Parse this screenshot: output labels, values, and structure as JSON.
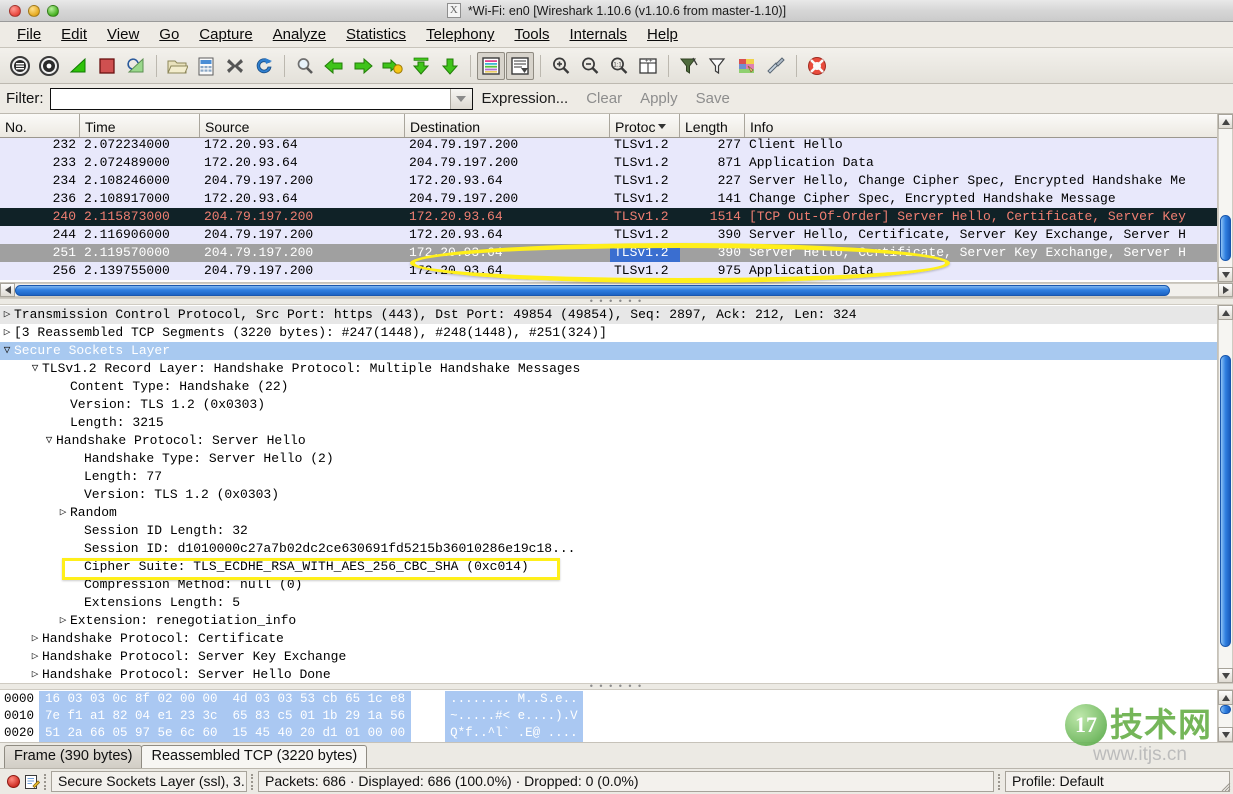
{
  "window": {
    "title": "*Wi-Fi: en0   [Wireshark 1.10.6  (v1.10.6 from master-1.10)]",
    "app_icon": "X"
  },
  "menu": {
    "items": [
      {
        "label": "File"
      },
      {
        "label": "Edit"
      },
      {
        "label": "View"
      },
      {
        "label": "Go"
      },
      {
        "label": "Capture"
      },
      {
        "label": "Analyze"
      },
      {
        "label": "Statistics"
      },
      {
        "label": "Telephony"
      },
      {
        "label": "Tools"
      },
      {
        "label": "Internals"
      },
      {
        "label": "Help"
      }
    ]
  },
  "toolbar": {
    "buttons": [
      {
        "name": "interfaces-icon"
      },
      {
        "name": "capture-options-icon"
      },
      {
        "name": "start-capture-icon"
      },
      {
        "name": "stop-capture-icon"
      },
      {
        "name": "restart-capture-icon"
      },
      {
        "name": "open-file-icon"
      },
      {
        "name": "save-file-icon"
      },
      {
        "name": "close-file-icon"
      },
      {
        "name": "reload-file-icon"
      },
      {
        "name": "find-packet-icon"
      },
      {
        "name": "go-back-icon"
      },
      {
        "name": "go-forward-icon"
      },
      {
        "name": "go-to-packet-icon"
      },
      {
        "name": "go-first-packet-icon"
      },
      {
        "name": "go-last-packet-icon"
      },
      {
        "name": "colorize-icon"
      },
      {
        "name": "auto-scroll-icon"
      },
      {
        "name": "zoom-in-icon"
      },
      {
        "name": "zoom-out-icon"
      },
      {
        "name": "zoom-normal-icon"
      },
      {
        "name": "resize-columns-icon"
      },
      {
        "name": "capture-filters-icon"
      },
      {
        "name": "display-filters-icon"
      },
      {
        "name": "coloring-rules-icon"
      },
      {
        "name": "preferences-icon"
      },
      {
        "name": "help-icon"
      }
    ]
  },
  "filter": {
    "label": "Filter:",
    "value": "",
    "placeholder": "",
    "expression_label": "Expression...",
    "clear_label": "Clear",
    "apply_label": "Apply",
    "save_label": "Save"
  },
  "packet_list": {
    "columns": [
      {
        "label": "No.",
        "sorted": false
      },
      {
        "label": "Time",
        "sorted": false
      },
      {
        "label": "Source",
        "sorted": false
      },
      {
        "label": "Destination",
        "sorted": false
      },
      {
        "label": "Protoc",
        "sorted": true
      },
      {
        "label": "Length",
        "sorted": false
      },
      {
        "label": "Info",
        "sorted": false
      }
    ],
    "rows": [
      {
        "no": "232",
        "time": "2.072234000",
        "src": "172.20.93.64",
        "dst": "204.79.197.200",
        "proto": "TLSv1.2",
        "len": "277",
        "info": "Client Hello",
        "style": "odd"
      },
      {
        "no": "233",
        "time": "2.072489000",
        "src": "172.20.93.64",
        "dst": "204.79.197.200",
        "proto": "TLSv1.2",
        "len": "871",
        "info": "Application Data",
        "style": "odd"
      },
      {
        "no": "234",
        "time": "2.108246000",
        "src": "204.79.197.200",
        "dst": "172.20.93.64",
        "proto": "TLSv1.2",
        "len": "227",
        "info": "Server Hello, Change Cipher Spec, Encrypted Handshake Me",
        "style": "odd"
      },
      {
        "no": "236",
        "time": "2.108917000",
        "src": "172.20.93.64",
        "dst": "204.79.197.200",
        "proto": "TLSv1.2",
        "len": "141",
        "info": "Change Cipher Spec, Encrypted Handshake Message",
        "style": "odd"
      },
      {
        "no": "240",
        "time": "2.115873000",
        "src": "204.79.197.200",
        "dst": "172.20.93.64",
        "proto": "TLSv1.2",
        "len": "1514",
        "info": "[TCP Out-Of-Order] Server Hello, Certificate, Server Key",
        "style": "bad"
      },
      {
        "no": "244",
        "time": "2.116906000",
        "src": "204.79.197.200",
        "dst": "172.20.93.64",
        "proto": "TLSv1.2",
        "len": "390",
        "info": "Server Hello, Certificate, Server Key Exchange, Server H",
        "style": "odd"
      },
      {
        "no": "251",
        "time": "2.119570000",
        "src": "204.79.197.200",
        "dst": "172.20.93.64",
        "proto": "TLSv1.2",
        "len": "390",
        "info": "Server Hello, Certificate, Server Key Exchange, Server H",
        "style": "sel"
      },
      {
        "no": "256",
        "time": "2.139755000",
        "src": "204.79.197.200",
        "dst": "172.20.93.64",
        "proto": "TLSv1.2",
        "len": "975",
        "info": "Application Data",
        "style": "odd"
      }
    ]
  },
  "detail_tree": {
    "rows": [
      {
        "indent": 0,
        "twisty": "collapsed",
        "text": "Transmission Control Protocol, Src Port: https (443), Dst Port: 49854 (49854), Seq: 2897, Ack: 212, Len: 324",
        "style": "shaded"
      },
      {
        "indent": 0,
        "twisty": "collapsed",
        "text": "[3 Reassembled TCP Segments (3220 bytes): #247(1448), #248(1448), #251(324)]",
        "style": "plain"
      },
      {
        "indent": 0,
        "twisty": "expanded",
        "text": "Secure Sockets Layer",
        "style": "ssl-sel"
      },
      {
        "indent": 1,
        "twisty": "expanded",
        "text": "TLSv1.2 Record Layer: Handshake Protocol: Multiple Handshake Messages",
        "style": "plain"
      },
      {
        "indent": 2,
        "twisty": "none",
        "text": "Content Type: Handshake (22)",
        "style": "plain"
      },
      {
        "indent": 2,
        "twisty": "none",
        "text": "Version: TLS 1.2 (0x0303)",
        "style": "plain"
      },
      {
        "indent": 2,
        "twisty": "none",
        "text": "Length: 3215",
        "style": "plain"
      },
      {
        "indent": 2,
        "twisty": "expanded",
        "text": "Handshake Protocol: Server Hello",
        "style": "plain"
      },
      {
        "indent": 3,
        "twisty": "none",
        "text": "Handshake Type: Server Hello (2)",
        "style": "plain"
      },
      {
        "indent": 3,
        "twisty": "none",
        "text": "Length: 77",
        "style": "plain"
      },
      {
        "indent": 3,
        "twisty": "none",
        "text": "Version: TLS 1.2 (0x0303)",
        "style": "plain"
      },
      {
        "indent": 3,
        "twisty": "collapsed",
        "text": "Random",
        "style": "plain"
      },
      {
        "indent": 3,
        "twisty": "none",
        "text": "Session ID Length: 32",
        "style": "plain"
      },
      {
        "indent": 3,
        "twisty": "none",
        "text": "Session ID: d1010000c27a7b02dc2ce630691fd5215b36010286e19c18...",
        "style": "plain"
      },
      {
        "indent": 3,
        "twisty": "none",
        "text": "Cipher Suite: TLS_ECDHE_RSA_WITH_AES_256_CBC_SHA (0xc014)",
        "style": "plain"
      },
      {
        "indent": 3,
        "twisty": "none",
        "text": "Compression Method: null (0)",
        "style": "plain"
      },
      {
        "indent": 3,
        "twisty": "none",
        "text": "Extensions Length: 5",
        "style": "plain"
      },
      {
        "indent": 3,
        "twisty": "collapsed",
        "text": "Extension: renegotiation_info",
        "style": "plain"
      },
      {
        "indent": 2,
        "twisty": "collapsed",
        "text": "Handshake Protocol: Certificate",
        "style": "plain"
      },
      {
        "indent": 2,
        "twisty": "collapsed",
        "text": "Handshake Protocol: Server Key Exchange",
        "style": "plain"
      },
      {
        "indent": 2,
        "twisty": "collapsed",
        "text": "Handshake Protocol: Server Hello Done",
        "style": "plain"
      }
    ]
  },
  "hex_pane": {
    "rows": [
      {
        "offset": "0000",
        "bytes": "16 03 03 0c 8f 02 00 00  4d 03 03 53 cb 65 1c e8",
        "ascii": "........ M..S.e.."
      },
      {
        "offset": "0010",
        "bytes": "7e f1 a1 82 04 e1 23 3c  65 83 c5 01 1b 29 1a 56",
        "ascii": "~.....#< e....).V"
      },
      {
        "offset": "0020",
        "bytes": "51 2a 66 05 97 5e 6c 60  15 45 40 20 d1 01 00 00",
        "ascii": "Q*f..^l` .E@ ...."
      }
    ]
  },
  "bottom_tabs": [
    {
      "label": "Frame (390 bytes)",
      "active": true
    },
    {
      "label": "Reassembled TCP (3220 bytes)",
      "active": false
    }
  ],
  "status_bar": {
    "expert_text": "Secure Sockets Layer (ssl), 3...",
    "packets_text": "Packets: 686 · Displayed: 686 (100.0%)  · Dropped: 0 (0.0%)",
    "profile_text": "Profile: Default"
  },
  "annotations": {
    "ellipse_label": "highlight-ellipse-destination-row",
    "rect_label": "highlight-rect-cipher-suite"
  },
  "watermark": {
    "badge": "17",
    "brand": "技术网",
    "url": "www.itjs.cn"
  }
}
